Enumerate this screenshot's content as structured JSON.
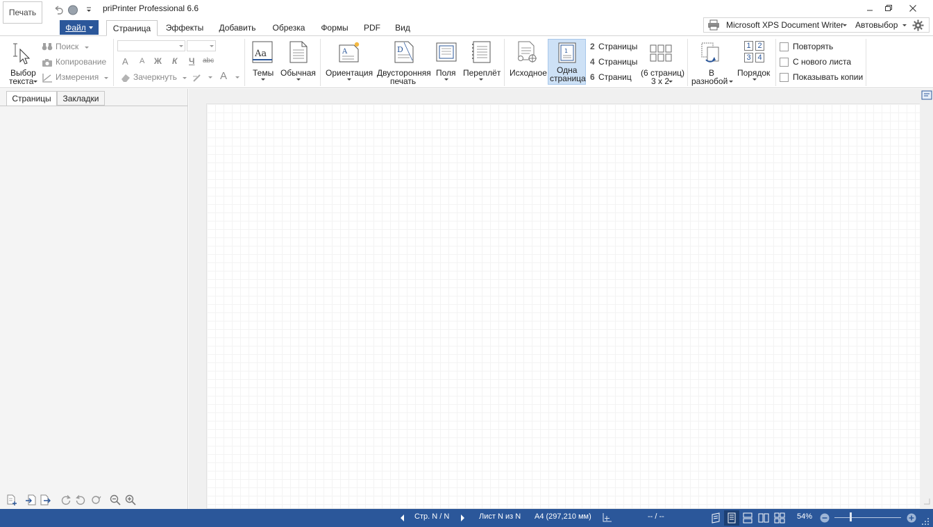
{
  "app": {
    "print_button": "Печать",
    "title": "priPrinter Professional 6.6"
  },
  "tabs": {
    "file": "Файл",
    "items": [
      "Страница",
      "Эффекты",
      "Добавить",
      "Обрезка",
      "Формы",
      "PDF",
      "Вид"
    ],
    "active": "Страница"
  },
  "printer": {
    "name": "Microsoft XPS Document Writer",
    "auto": "Автовыбор"
  },
  "ribbon": {
    "text_select": [
      "Выбор",
      "текста"
    ],
    "search": "Поиск",
    "copy": "Копирование",
    "measure": "Измерения",
    "strike": "Зачеркнуть",
    "fmt": {
      "grow": "A",
      "shrink": "A",
      "bold": "Ж",
      "italic": "К",
      "underline": "Ч",
      "strikeabc": "abc",
      "fontcolor": "A"
    },
    "themes": "Темы",
    "normal": "Обычная",
    "orientation": "Ориентация",
    "duplex": [
      "Двусторонняя",
      "печать"
    ],
    "margins": "Поля",
    "binding": "Переплёт",
    "original": "Исходное",
    "one_page": [
      "Одна",
      "страница"
    ],
    "pages2": {
      "num": "2",
      "label": "Страницы"
    },
    "pages4": {
      "num": "4",
      "label": "Страницы"
    },
    "pages6": {
      "num": "6",
      "label": "Страниц"
    },
    "six_pages": [
      "(6 страниц)",
      "3 x 2"
    ],
    "collate": [
      "В",
      "разнобой"
    ],
    "order": "Порядок",
    "order_nums": [
      "1",
      "2",
      "3",
      "4"
    ],
    "repeat": "Повторять",
    "new_sheet": "С нового листа",
    "show_copies": "Показывать копии"
  },
  "panel": {
    "tab_pages": "Страницы",
    "tab_bookmarks": "Закладки"
  },
  "status": {
    "page": "Стр. N / N",
    "sheet": "Лист N из N",
    "paper": "A4 (297,210 мм)",
    "coords": "-- / --",
    "zoom": "54%",
    "zoom_level": 0.54
  },
  "colors": {
    "accent": "#2b579a",
    "selected": "#cde1f6"
  }
}
